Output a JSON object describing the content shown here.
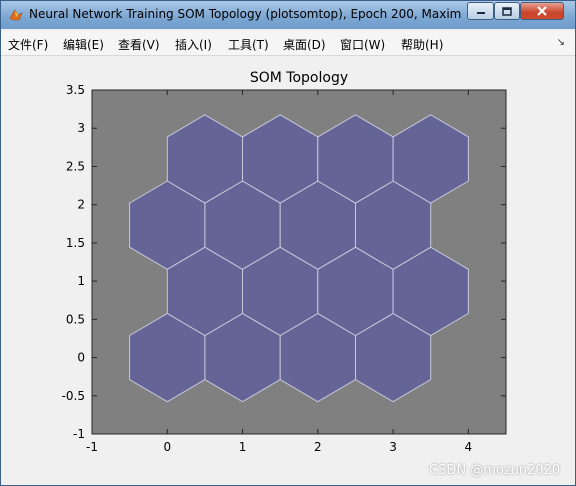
{
  "window": {
    "title": "Neural Network Training SOM Topology (plotsomtop), Epoch 200, Maxim",
    "icon": "matlab-icon"
  },
  "menu": {
    "items": [
      "文件(F)",
      "编辑(E)",
      "查看(V)",
      "插入(I)",
      "工具(T)",
      "桌面(D)",
      "窗口(W)",
      "帮助(H)"
    ]
  },
  "chart_data": {
    "type": "scatter",
    "title": "SOM Topology",
    "xlabel": "",
    "ylabel": "",
    "xlim": [
      -1,
      4.5
    ],
    "ylim": [
      -1,
      3.5
    ],
    "xticks": [
      "-1",
      "0",
      "1",
      "2",
      "3",
      "4"
    ],
    "yticks": [
      "-1",
      "-0.5",
      "0",
      "0.5",
      "1",
      "1.5",
      "2",
      "2.5",
      "3",
      "3.5"
    ],
    "background": "#808080",
    "neuron_color": "#646496",
    "edge_color": "#c8c8dc",
    "neurons": [
      {
        "x": 0,
        "y": 0
      },
      {
        "x": 1,
        "y": 0
      },
      {
        "x": 2,
        "y": 0
      },
      {
        "x": 3,
        "y": 0
      },
      {
        "x": 0.5,
        "y": 0.866
      },
      {
        "x": 1.5,
        "y": 0.866
      },
      {
        "x": 2.5,
        "y": 0.866
      },
      {
        "x": 3.5,
        "y": 0.866
      },
      {
        "x": 0,
        "y": 1.732
      },
      {
        "x": 1,
        "y": 1.732
      },
      {
        "x": 2,
        "y": 1.732
      },
      {
        "x": 3,
        "y": 1.732
      },
      {
        "x": 0.5,
        "y": 2.598
      },
      {
        "x": 1.5,
        "y": 2.598
      },
      {
        "x": 2.5,
        "y": 2.598
      },
      {
        "x": 3.5,
        "y": 2.598
      }
    ]
  },
  "watermark": "CSDN @mozun2020"
}
